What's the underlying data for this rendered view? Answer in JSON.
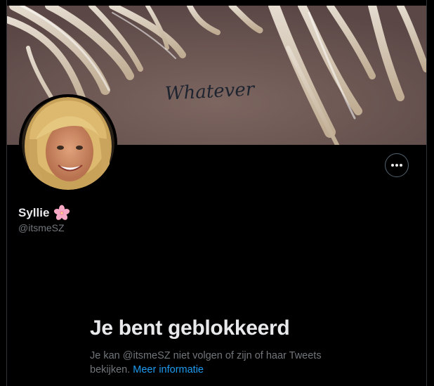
{
  "profile": {
    "banner_text": "Whatever",
    "display_name": "Syllie",
    "emoji": "🌸",
    "handle": "@itsmeSZ"
  },
  "actions": {
    "more_icon": "more-horizontal-icon"
  },
  "blocked": {
    "title": "Je bent geblokkeerd",
    "description_prefix": "Je kan @itsmeSZ niet volgen of zijn of haar Tweets bekijken.",
    "learn_more": "Meer informatie"
  },
  "colors": {
    "background": "#000000",
    "text_primary": "#e7e9ea",
    "text_secondary": "#71767b",
    "link": "#1d9bf0",
    "border": "#2f3336"
  }
}
